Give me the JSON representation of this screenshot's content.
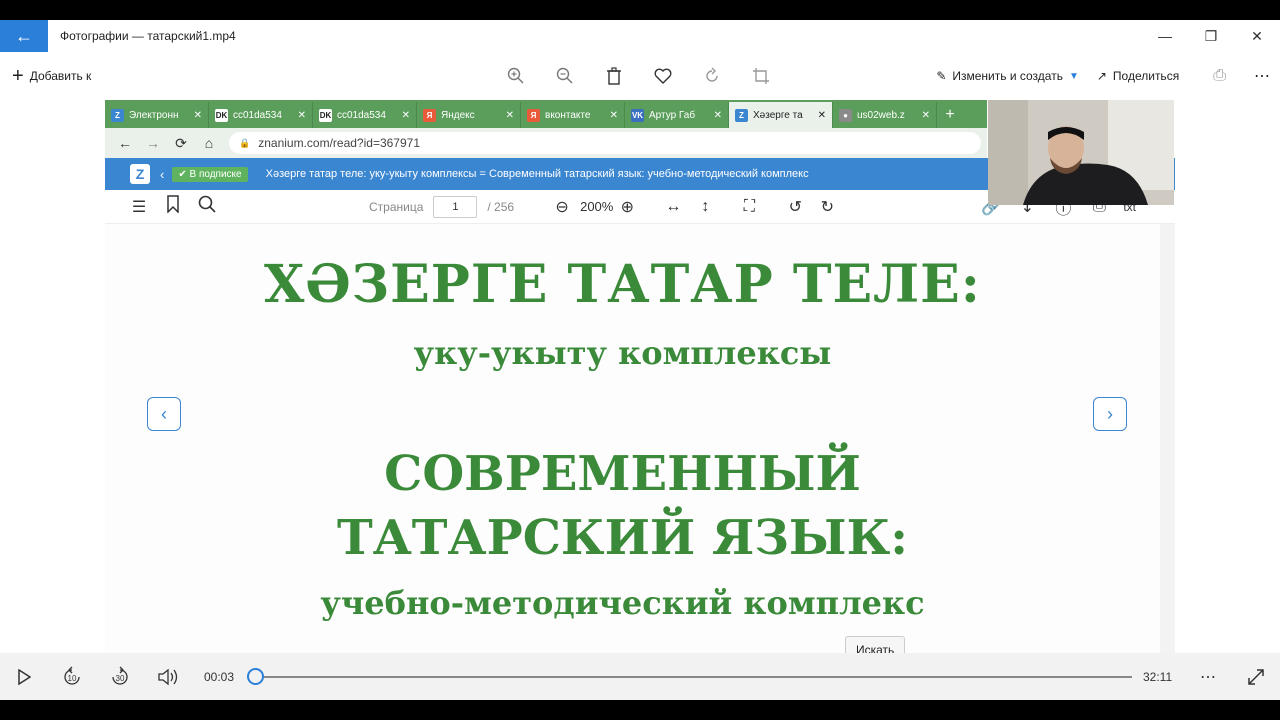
{
  "window": {
    "title": "Фотографии — татарский1.mp4",
    "accent": "#2b7fd8"
  },
  "toolbar": {
    "add_to": "Добавить к",
    "edit_create": "Изменить и создать",
    "share": "Поделиться"
  },
  "browser": {
    "tabs": [
      {
        "label": "Электронн",
        "icon": "Z",
        "icon_bg": "#3b86d1"
      },
      {
        "label": "cc01da534",
        "icon": "DK",
        "icon_bg": "#ffffff"
      },
      {
        "label": "cc01da534",
        "icon": "DK",
        "icon_bg": "#ffffff"
      },
      {
        "label": "Яндекс",
        "icon": "Я",
        "icon_bg": "#e85a3a"
      },
      {
        "label": "вконтакте",
        "icon": "Я",
        "icon_bg": "#e85a3a"
      },
      {
        "label": "Артур Габ",
        "icon": "VK",
        "icon_bg": "#3b6fc0"
      },
      {
        "label": "Хәзерге та",
        "icon": "Z",
        "icon_bg": "#3b86d1"
      },
      {
        "label": "us02web.z",
        "icon": "●",
        "icon_bg": "#8a8a8a"
      }
    ],
    "url": "znanium.com/read?id=367971"
  },
  "site": {
    "subscription_badge": "В подписке",
    "book_title": "Хәзерге татар теле: уку-укыту комплексы = Современный татарский язык: учебно-методический комплекс"
  },
  "reader": {
    "page_label": "Страница",
    "page_current": "1",
    "page_total": "/ 256",
    "zoom": "200%",
    "txt_label": "txt"
  },
  "book_page": {
    "line1": "ХӘЗЕРГЕ ТАТАР ТЕЛЕ:",
    "line2": "уку-укыту комплексы",
    "line3": "СОВРЕМЕННЫЙ",
    "line4": "ТАТАРСКИЙ ЯЗЫК:",
    "line5": "учебно-методический комплекс",
    "text_color": "#3a8a3a"
  },
  "tooltip": "Искать",
  "player": {
    "current_time": "00:03",
    "total_time": "32:11",
    "skip_back": "10",
    "skip_forward": "30",
    "progress": 0.0016
  }
}
